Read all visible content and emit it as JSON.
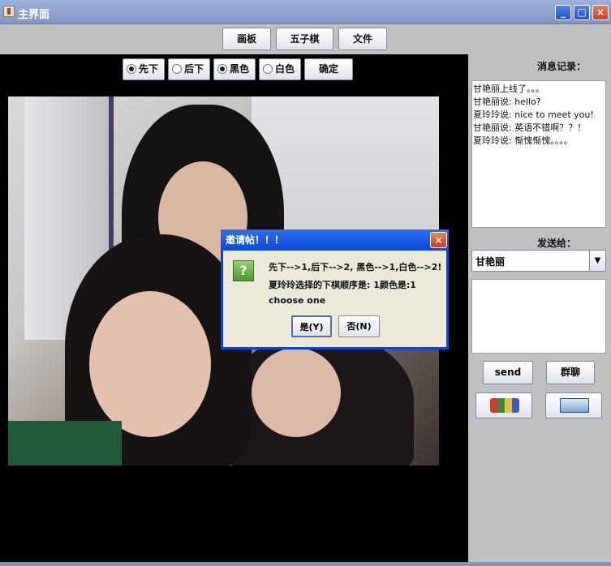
{
  "window": {
    "title": "主界面",
    "controls": [
      "_",
      "□",
      "×"
    ]
  },
  "toolbar": {
    "draw_label": "画板",
    "gomoku_label": "五子棋",
    "file_label": "文件"
  },
  "options": {
    "first_label": "先下",
    "second_label": "后下",
    "black_label": "黑色",
    "white_label": "白色",
    "confirm_label": "确定",
    "first_checked": true,
    "second_checked": false,
    "black_checked": true,
    "white_checked": false
  },
  "dialog": {
    "title": "邀请帖！！！",
    "icon": "question-icon",
    "icon_glyph": "?",
    "line1": "先下-->1,后下-->2, 黑色-->1,白色-->2!",
    "line2": "夏玲玲选择的下棋顺序是: 1颜色是:1",
    "line3": "choose one",
    "yes_label": "是(Y)",
    "no_label": "否(N)",
    "close_glyph": "×"
  },
  "sidebar": {
    "log_label": "消息记录：",
    "messages": [
      "甘艳丽上线了。。。",
      "甘艳丽说: hello?",
      "夏玲玲说: nice to meet you!",
      "甘艳丽说: 英语不错啊？？！",
      "夏玲玲说: 惭愧惭愧。。。。"
    ],
    "send_to_label": "发送给：",
    "recipient": "甘艳丽",
    "combo_arrow": "▼",
    "send_label": "send",
    "group_label": "群聊"
  }
}
